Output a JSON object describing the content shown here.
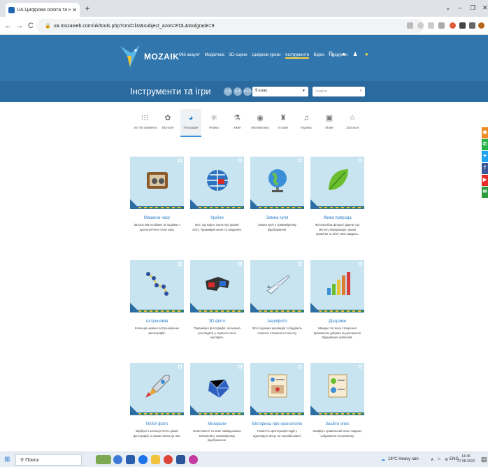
{
  "browser": {
    "tab_title": "UA Цифрова освіта та навчанн",
    "new_tab": "+",
    "url": "ua.mozaweb.com/uk/tools.php?cmd=list&subject_azon=FOL&toolgrade=9"
  },
  "site": {
    "brand": "MOZAIK",
    "menu": [
      "Мій акаунт",
      "Медіатека",
      "3D-сцени",
      "Цифрові уроки",
      "Інструменти",
      "Відео",
      "Продукти"
    ],
    "active_menu": "Інструменти",
    "page_title": "Інструменти та ігри",
    "grade_select": "9 клас",
    "search_placeholder": "Знайти"
  },
  "categories": [
    {
      "label": "Всі інструменти",
      "icon": "grid-icon"
    },
    {
      "label": "Біологія",
      "icon": "plant-icon"
    },
    {
      "label": "Географія",
      "icon": "globe-icon"
    },
    {
      "label": "Фізика",
      "icon": "atom-icon"
    },
    {
      "label": "Хімія",
      "icon": "flask-icon"
    },
    {
      "label": "Математика",
      "icon": "math-icon"
    },
    {
      "label": "Історія",
      "icon": "column-icon"
    },
    {
      "label": "Музика",
      "icon": "music-icon"
    },
    {
      "label": "Мови",
      "icon": "speech-icon"
    },
    {
      "label": "Загальні",
      "icon": "star-icon"
    }
  ],
  "active_category": "Географія",
  "cards": [
    {
      "title": "Машина часу",
      "desc": "Зв'язок між особами та подіями з хронологічної точки зору.",
      "icon": "radio-icon"
    },
    {
      "title": "Країни",
      "desc": "Все, що варто знати про країни світу. Тривимірні мапи та завдання.",
      "icon": "globe-flag-icon"
    },
    {
      "title": "Земна куля",
      "desc": "Земна куля у тривимірному відображенні.",
      "icon": "earth-globe-icon"
    },
    {
      "title": "Жива природа",
      "desc": "Фотоальбом флори і фауни, що містить інформацію, цікаві примітки та різні типи завдань.",
      "icon": "leaf-icon"
    },
    {
      "title": "Астрономія",
      "desc": "Колекція цікавих астрономічних фотографій.",
      "icon": "constellation-icon"
    },
    {
      "title": "3D-фото",
      "desc": "Тривимірні фотографії, які можна розглядати у червоно-синіх окулярах.",
      "icon": "3d-glasses-icon"
    },
    {
      "title": "Аерофото",
      "desc": "Фото відомих краєвидів та будівель з висоти пташиного польоту.",
      "icon": "airplane-icon"
    },
    {
      "title": "Діаграми",
      "desc": "Швидке та легке створення вражаючих діаграм за допомогою вбудованих шаблонів.",
      "icon": "bar-chart-icon"
    },
    {
      "title": "NASA фото",
      "desc": "Відбірні з колекції NASA цікаві фотографії, а також описи до них.",
      "icon": "rocket-icon"
    },
    {
      "title": "Мінерали",
      "desc": "Властивості та опис найвідоміших мінералів у тривимірному відображенні.",
      "icon": "gem-icon"
    },
    {
      "title": "Вікторина про хронологію",
      "desc": "Помістіть фотографії подій у відповідне місце на часовій шкалі.",
      "icon": "timeline-quiz-icon"
    },
    {
      "title": "Знайти опис",
      "desc": "Знайдіть правильний опис людини, зображеної на малюнку.",
      "icon": "find-desc-icon"
    }
  ],
  "social": [
    "rss",
    "whatsapp",
    "twitter",
    "facebook",
    "youtube",
    "mail"
  ],
  "taskbar": {
    "search": "Поиск",
    "weather": "18°C Heavy rain",
    "lang": "ENG",
    "time": "14:46",
    "date": "27.08.2023"
  }
}
